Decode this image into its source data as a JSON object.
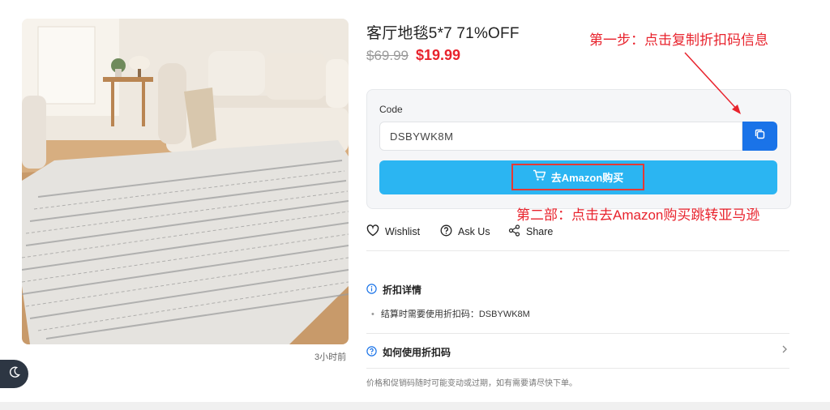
{
  "product": {
    "title": "客厅地毯5*7 71%OFF",
    "old_price": "$69.99",
    "new_price": "$19.99",
    "time_ago": "3小时前"
  },
  "code_panel": {
    "label": "Code",
    "code_value": "DSBYWK8M",
    "buy_label": "去Amazon购买"
  },
  "annotations": {
    "step1": "第一步：点击复制折扣码信息",
    "step2": "第二部：点击去Amazon购买跳转亚马逊"
  },
  "actions": {
    "wishlist": "Wishlist",
    "ask_us": "Ask Us",
    "share": "Share"
  },
  "details": {
    "heading": "折扣详情",
    "item": "结算时需要使用折扣码：DSBYWK8M",
    "howto_heading": "如何使用折扣码",
    "footnote": "价格和促销码随时可能变动或过期，如有需要请尽快下单。"
  },
  "colors": {
    "price_red": "#e8232d",
    "copy_blue": "#1a73e8",
    "buy_button": "#2bb5f2",
    "highlight": "#e53935"
  },
  "icons": [
    "copy-icon",
    "cart-icon",
    "heart-icon",
    "question-circle-icon",
    "share-icon",
    "info-icon",
    "chevron-right-icon",
    "moon-icon"
  ]
}
